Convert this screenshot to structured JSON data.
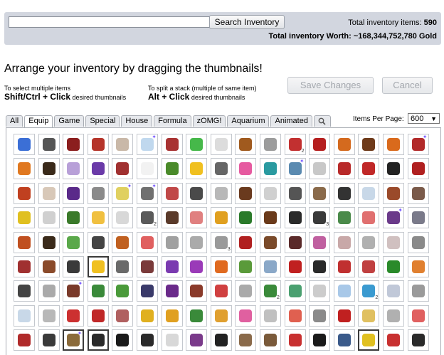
{
  "search": {
    "value": "",
    "placeholder": "",
    "button_label": "Search Inventory"
  },
  "totals": {
    "items_label": "Total inventory items:",
    "items_value": "590",
    "worth_label": "Total inventory Worth:",
    "worth_value": "~168,344,752,780 Gold"
  },
  "headline": "Arrange your inventory by dragging the thumbnails!",
  "hints": {
    "multi_intro": "To select multiple items",
    "multi_key": "Shift/Ctrl + Click",
    "multi_suffix": "desired thumbnails",
    "split_intro": "To split a stack (multiple of same item)",
    "split_key": "Alt + Click",
    "split_suffix": "desired thumbnails"
  },
  "buttons": {
    "save": "Save Changes",
    "cancel": "Cancel"
  },
  "tabs": [
    {
      "label": "All"
    },
    {
      "label": "Equip",
      "active": true
    },
    {
      "label": "Game"
    },
    {
      "label": "Special"
    },
    {
      "label": "House"
    },
    {
      "label": "Formula"
    },
    {
      "label": "zOMG!"
    },
    {
      "label": "Aquarium"
    },
    {
      "label": "Animated"
    }
  ],
  "search_tab_icon": "magnifier-icon",
  "per_page": {
    "label": "Items Per Page:",
    "value": "600"
  },
  "grid": {
    "cells": [
      {
        "color": "#3b6fd6"
      },
      {
        "color": "#555555"
      },
      {
        "color": "#8b1e1e"
      },
      {
        "color": "#b5342a"
      },
      {
        "color": "#c9b8a8"
      },
      {
        "color": "#c0d8ee",
        "badge": "✦"
      },
      {
        "color": "#a83232"
      },
      {
        "color": "#46b84a"
      },
      {
        "color": "#dcdcdc"
      },
      {
        "color": "#a05a1e"
      },
      {
        "color": "#9c9c9c"
      },
      {
        "color": "#c23030",
        "badge": "2"
      },
      {
        "color": "#b51f1f"
      },
      {
        "color": "#d46a1e"
      },
      {
        "color": "#6e3a1a"
      },
      {
        "color": "#d96a1c"
      },
      {
        "color": "#b22a2a",
        "badge": "✦"
      },
      {
        "color": "#e07820"
      },
      {
        "color": "#3a2a1a"
      },
      {
        "color": "#b8a0d8"
      },
      {
        "color": "#6a3aa8"
      },
      {
        "color": "#a03030"
      },
      {
        "color": "#f2f2f2"
      },
      {
        "color": "#4a8a2a"
      },
      {
        "color": "#f0c020"
      },
      {
        "color": "#666666"
      },
      {
        "color": "#e65aa0"
      },
      {
        "color": "#2a9aa0"
      },
      {
        "color": "#5a8ab0",
        "badge": "✦"
      },
      {
        "color": "#c8c8c8"
      },
      {
        "color": "#b82a2a"
      },
      {
        "color": "#c02828"
      },
      {
        "color": "#222222"
      },
      {
        "color": "#b02020"
      },
      {
        "color": "#c04020"
      },
      {
        "color": "#d8c8b8"
      },
      {
        "color": "#5a2a8a"
      },
      {
        "color": "#8a8a8a"
      },
      {
        "color": "#e0d060",
        "badge": "✦"
      },
      {
        "color": "#707070",
        "badge": "✦"
      },
      {
        "color": "#c04848"
      },
      {
        "color": "#4a4a4a"
      },
      {
        "color": "#b8b8b8"
      },
      {
        "color": "#6a3a1e"
      },
      {
        "color": "#d0d0d0"
      },
      {
        "color": "#555555"
      },
      {
        "color": "#8a6a4a"
      },
      {
        "color": "#333333"
      },
      {
        "color": "#c8d8e8"
      },
      {
        "color": "#9a4a2a"
      },
      {
        "color": "#7a5a4a"
      },
      {
        "color": "#e0c020"
      },
      {
        "color": "#d0d0d0"
      },
      {
        "color": "#3a7a2a"
      },
      {
        "color": "#f0c040"
      },
      {
        "color": "#d8d8d8"
      },
      {
        "color": "#5a5a5a",
        "badge": "2"
      },
      {
        "color": "#5a3a2a"
      },
      {
        "color": "#e08080"
      },
      {
        "color": "#e0a020"
      },
      {
        "color": "#2a7a2a"
      },
      {
        "color": "#6a3a1a"
      },
      {
        "color": "#2a2a2a"
      },
      {
        "color": "#3a3a3a",
        "badge": "3"
      },
      {
        "color": "#4a8a4a"
      },
      {
        "color": "#e07070"
      },
      {
        "color": "#6a3a8a",
        "badge": "✦"
      },
      {
        "color": "#7a7a8a"
      },
      {
        "color": "#c05020"
      },
      {
        "color": "#3a2a1a"
      },
      {
        "color": "#5aa84a"
      },
      {
        "color": "#444444"
      },
      {
        "color": "#c06020"
      },
      {
        "color": "#e06060"
      },
      {
        "color": "#a0a0a0"
      },
      {
        "color": "#aaaaaa"
      },
      {
        "color": "#9a9a9a",
        "badge": "3"
      },
      {
        "color": "#b02020"
      },
      {
        "color": "#7a4a2a"
      },
      {
        "color": "#5a2a2a"
      },
      {
        "color": "#c060a0"
      },
      {
        "color": "#c8a8a8"
      },
      {
        "color": "#b0b0b0"
      },
      {
        "color": "#d0c0c0"
      },
      {
        "color": "#8a8a8a"
      },
      {
        "color": "#a03030"
      },
      {
        "color": "#8a4a2a"
      },
      {
        "color": "#3a3a3a"
      },
      {
        "color": "#f0c020",
        "selected": true
      },
      {
        "color": "#6a6a6a"
      },
      {
        "color": "#7a3a3a"
      },
      {
        "color": "#7a3ab0"
      },
      {
        "color": "#9a3ab8"
      },
      {
        "color": "#e06a20"
      },
      {
        "color": "#5a9a3a"
      },
      {
        "color": "#8aa8c8"
      },
      {
        "color": "#c02020"
      },
      {
        "color": "#2a2a2a"
      },
      {
        "color": "#c03030"
      },
      {
        "color": "#c04040"
      },
      {
        "color": "#2a8a2a"
      },
      {
        "color": "#e08030"
      },
      {
        "color": "#444444"
      },
      {
        "color": "#aaaaaa"
      },
      {
        "color": "#7a3a2a",
        "badge": "✦"
      },
      {
        "color": "#3a8a3a"
      },
      {
        "color": "#4a9a3a"
      },
      {
        "color": "#3a3a6a"
      },
      {
        "color": "#6a2a8a"
      },
      {
        "color": "#8a3a2a"
      },
      {
        "color": "#d04040"
      },
      {
        "color": "#aaaaaa"
      },
      {
        "color": "#3a8a3a",
        "badge": "2"
      },
      {
        "color": "#4aa070"
      },
      {
        "color": "#cccccc"
      },
      {
        "color": "#a8c8e8"
      },
      {
        "color": "#3a9ad0",
        "badge": "2"
      },
      {
        "color": "#c0c8d8"
      },
      {
        "color": "#9a9a9a"
      },
      {
        "color": "#c8d8e8"
      },
      {
        "color": "#b8b8b8"
      },
      {
        "color": "#cc3030"
      },
      {
        "color": "#c02828"
      },
      {
        "color": "#b06060"
      },
      {
        "color": "#e0b020"
      },
      {
        "color": "#e0a020"
      },
      {
        "color": "#3a8a3a"
      },
      {
        "color": "#e0a030"
      },
      {
        "color": "#e060a0"
      },
      {
        "color": "#c0c0c0"
      },
      {
        "color": "#e06050"
      },
      {
        "color": "#8a8a8a"
      },
      {
        "color": "#c02020"
      },
      {
        "color": "#e0c060"
      },
      {
        "color": "#b0b0b0"
      },
      {
        "color": "#e06060"
      },
      {
        "color": "#b02a2a"
      },
      {
        "color": "#3a3a3a"
      },
      {
        "color": "#8a6a3a",
        "badge": "✦",
        "selected": true
      },
      {
        "color": "#2a2a2a",
        "selected": true
      },
      {
        "color": "#1a1a1a"
      },
      {
        "color": "#2a2a2a"
      },
      {
        "color": "#d8d8d8"
      },
      {
        "color": "#7a3a8a"
      },
      {
        "color": "#222222"
      },
      {
        "color": "#8a6a4a"
      },
      {
        "color": "#7a5a3a"
      },
      {
        "color": "#c83030"
      },
      {
        "color": "#1a1a1a"
      },
      {
        "color": "#3a5a8a"
      },
      {
        "color": "#e0c020",
        "selected": true
      },
      {
        "color": "#c83030"
      },
      {
        "color": "#2a2a2a"
      }
    ]
  }
}
